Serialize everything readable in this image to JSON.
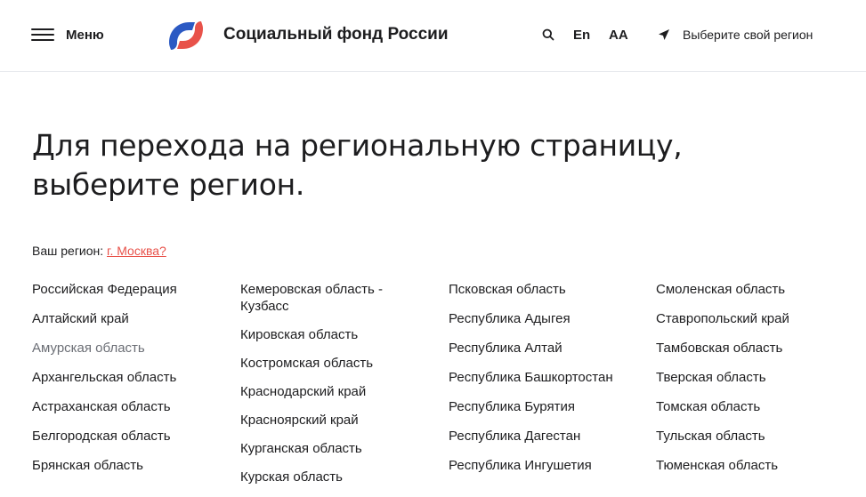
{
  "header": {
    "menu_label": "Меню",
    "brand": "Социальный фонд России",
    "lang": "En",
    "font_size_toggle": "AA",
    "region_select": "Выберите свой регион",
    "accent_blue": "#2b59c3",
    "accent_red": "#e8524a"
  },
  "page": {
    "title": "Для перехода на региональную страницу, выберите регион.",
    "your_region_label": "Ваш регион: ",
    "your_region_link": "г. Москва?"
  },
  "regions": {
    "col1": [
      "Российская Федерация",
      "Алтайский край",
      "Амурская область",
      "Архангельская область",
      "Астраханская область",
      "Белгородская область",
      "Брянская область"
    ],
    "col2": [
      "Кемеровская область - Кузбасс",
      "Кировская область",
      "Костромская область",
      "Краснодарский край",
      "Красноярский край",
      "Курганская область",
      "Курская область"
    ],
    "col3": [
      "Псковская область",
      "Республика Адыгея",
      "Республика Алтай",
      "Республика Башкортостан",
      "Республика Бурятия",
      "Республика Дагестан",
      "Республика Ингушетия"
    ],
    "col4": [
      "Смоленская область",
      "Ставропольский край",
      "Тамбовская область",
      "Тверская область",
      "Томская область",
      "Тульская область",
      "Тюменская область"
    ]
  }
}
